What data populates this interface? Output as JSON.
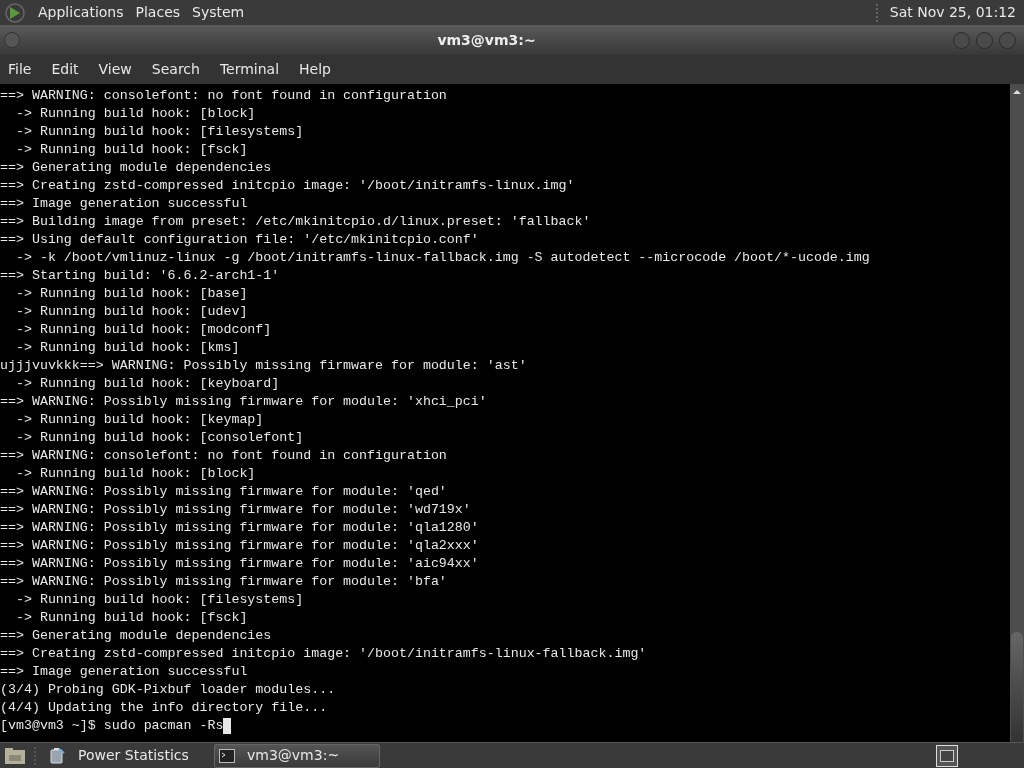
{
  "top_panel": {
    "menus": [
      "Applications",
      "Places",
      "System"
    ],
    "clock": "Sat Nov 25, 01:12"
  },
  "window": {
    "title": "vm3@vm3:~"
  },
  "menu_bar": [
    "File",
    "Edit",
    "View",
    "Search",
    "Terminal",
    "Help"
  ],
  "terminal": {
    "lines": [
      "==> WARNING: consolefont: no font found in configuration",
      "  -> Running build hook: [block]",
      "  -> Running build hook: [filesystems]",
      "  -> Running build hook: [fsck]",
      "==> Generating module dependencies",
      "==> Creating zstd-compressed initcpio image: '/boot/initramfs-linux.img'",
      "==> Image generation successful",
      "==> Building image from preset: /etc/mkinitcpio.d/linux.preset: 'fallback'",
      "==> Using default configuration file: '/etc/mkinitcpio.conf'",
      "  -> -k /boot/vmlinuz-linux -g /boot/initramfs-linux-fallback.img -S autodetect --microcode /boot/*-ucode.img",
      "==> Starting build: '6.6.2-arch1-1'",
      "  -> Running build hook: [base]",
      "  -> Running build hook: [udev]",
      "  -> Running build hook: [modconf]",
      "  -> Running build hook: [kms]",
      "ujjjvuvkkk==> WARNING: Possibly missing firmware for module: 'ast'",
      "  -> Running build hook: [keyboard]",
      "==> WARNING: Possibly missing firmware for module: 'xhci_pci'",
      "  -> Running build hook: [keymap]",
      "  -> Running build hook: [consolefont]",
      "==> WARNING: consolefont: no font found in configuration",
      "  -> Running build hook: [block]",
      "==> WARNING: Possibly missing firmware for module: 'qed'",
      "==> WARNING: Possibly missing firmware for module: 'wd719x'",
      "==> WARNING: Possibly missing firmware for module: 'qla1280'",
      "==> WARNING: Possibly missing firmware for module: 'qla2xxx'",
      "==> WARNING: Possibly missing firmware for module: 'aic94xx'",
      "==> WARNING: Possibly missing firmware for module: 'bfa'",
      "  -> Running build hook: [filesystems]",
      "  -> Running build hook: [fsck]",
      "==> Generating module dependencies",
      "==> Creating zstd-compressed initcpio image: '/boot/initramfs-linux-fallback.img'",
      "==> Image generation successful",
      "(3/4) Probing GDK-Pixbuf loader modules...",
      "(4/4) Updating the info directory file..."
    ],
    "prompt": "[vm3@vm3 ~]$ sudo pacman -Rs"
  },
  "taskbar": {
    "tasks": [
      {
        "label": "Power Statistics",
        "kind": "power",
        "selected": false
      },
      {
        "label": "vm3@vm3:~",
        "kind": "terminal",
        "selected": true
      }
    ]
  }
}
